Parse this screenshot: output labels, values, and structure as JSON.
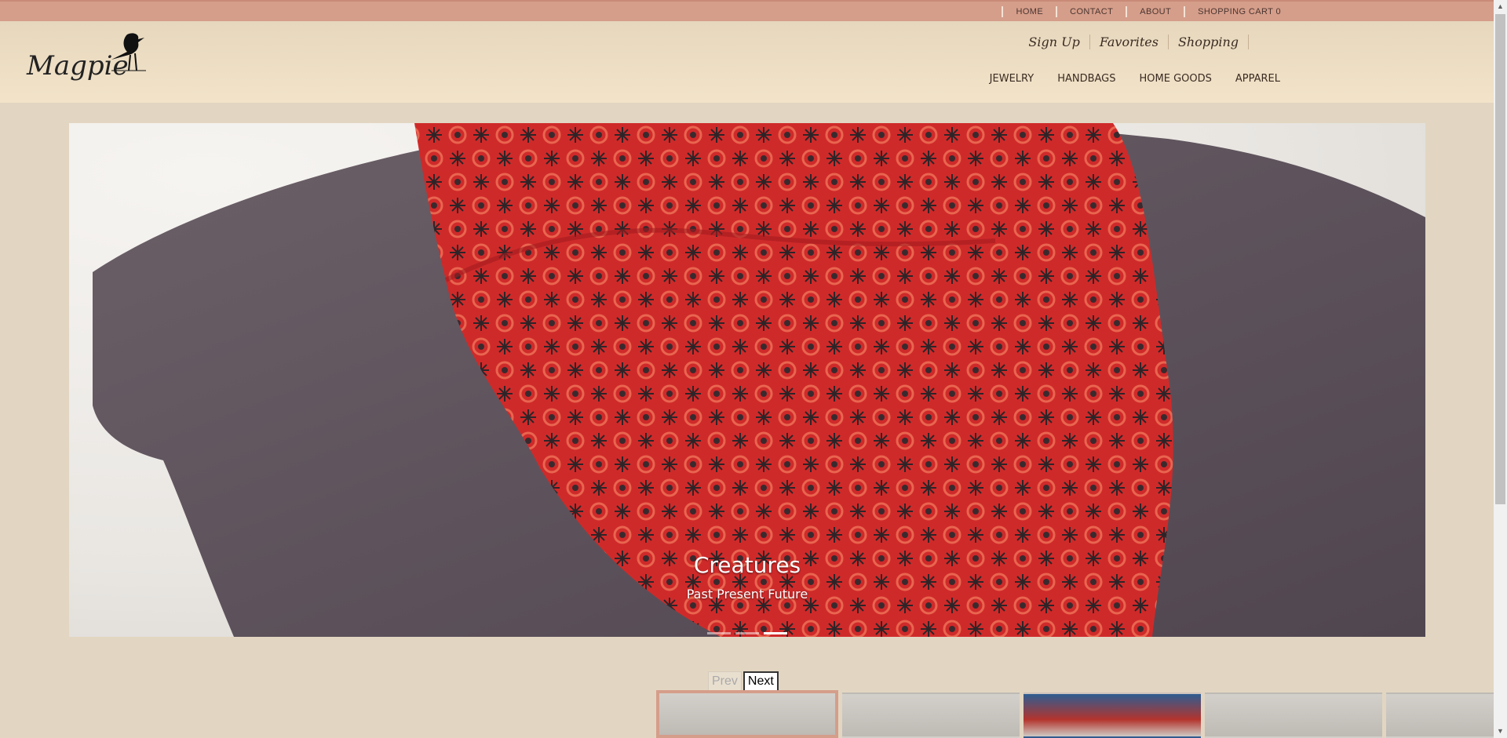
{
  "top_nav": [
    "HOME",
    "CONTACT",
    "ABOUT",
    "SHOPPING CART 0"
  ],
  "logo": {
    "text": "Magpie"
  },
  "secondary_nav": [
    "Sign Up",
    "Favorites",
    "Shopping"
  ],
  "category_nav": [
    "JEWELRY",
    "HANDBAGS",
    "HOME GOODS",
    "APPAREL"
  ],
  "hero": {
    "title": "Creatures",
    "subtitle": "Past Present Future",
    "slide_count": 3,
    "active_slide": 3
  },
  "pager": {
    "prev": "Prev",
    "next": "Next"
  },
  "thumbnails": {
    "count": 5,
    "selected": 1
  },
  "colors": {
    "topbar": "#d59e8a",
    "background": "#e2d6c2",
    "header": "#f2e3c9"
  }
}
